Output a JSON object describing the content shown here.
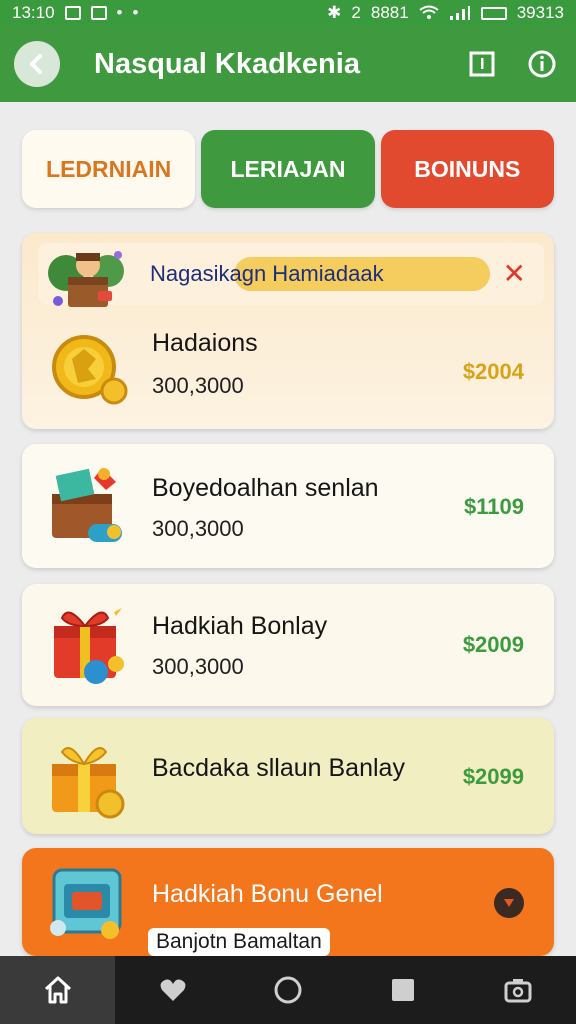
{
  "status_bar": {
    "time": "13:10",
    "signal_text": "2",
    "net_text": "8881",
    "battery_text": "39313"
  },
  "header": {
    "title": "Nasqual Kkadkenia",
    "icons": [
      "back-arrow-icon",
      "square-icon",
      "info-icon"
    ]
  },
  "tabs": [
    {
      "label": "LEDRNIAIN",
      "color": "#d9771f"
    },
    {
      "label": "LERIAJAN",
      "color": "#3f9a3f"
    },
    {
      "label": "BOINUNS",
      "color": "#e24a2f"
    }
  ],
  "notice": {
    "text": "Nagasikagn Hamiadaak",
    "close": "✕"
  },
  "items": [
    {
      "name": "Hadaions",
      "sub": "300,3000",
      "price": "$2004",
      "icon": "gold-coin-icon"
    },
    {
      "name": "Boyedoalhan senlan",
      "sub": "300,3000",
      "price": "$1109",
      "icon": "treasure-box-icon"
    },
    {
      "name": "Hadkiah Bonlay",
      "sub": "300,3000",
      "price": "$2009",
      "icon": "red-gift-icon"
    },
    {
      "name": "Bacdaka sllaun Banlay",
      "price": "$2099",
      "icon": "gold-gift-icon"
    },
    {
      "name": "Hadkiah Bonu Genel",
      "pill": "Banjotn Bamaltan",
      "icon": "chest-icon"
    }
  ],
  "bottom_nav": [
    "home-icon",
    "heart-icon",
    "circle-icon",
    "square-icon",
    "camera-icon"
  ]
}
